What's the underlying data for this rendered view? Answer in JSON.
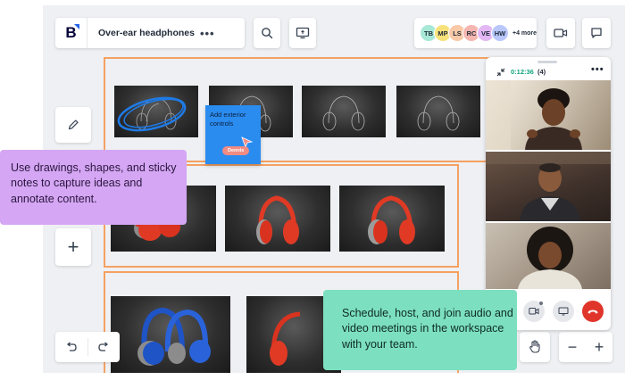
{
  "board": {
    "logo_letter": "B",
    "title": "Over-ear headphones",
    "more_label": "•••"
  },
  "collaborators": {
    "avatars": [
      {
        "initials": "TB",
        "color": "#a7e8d6"
      },
      {
        "initials": "MP",
        "color": "#f7e27a"
      },
      {
        "initials": "LS",
        "color": "#f9c9a8"
      },
      {
        "initials": "RC",
        "color": "#f6b6b0"
      },
      {
        "initials": "VE",
        "color": "#e3b7f4"
      },
      {
        "initials": "HW",
        "color": "#b9c7fb"
      }
    ],
    "more_count": "+4 more"
  },
  "sticky_note": {
    "text": "Add exterior controls",
    "cursor_user": "Dennis",
    "color": "#2b8cf0"
  },
  "video_call": {
    "timer": "0:12:36",
    "participant_count": "(4)",
    "more_label": "•••"
  },
  "callouts": {
    "drawing_tip": "Use drawings, shapes, and sticky notes to capture ideas and annotate content.",
    "meetings_tip": "Schedule, host, and join audio and video meetings in the workspace with your team."
  },
  "zoom": {
    "minus": "−",
    "plus": "+"
  },
  "toolbar": {
    "add_label": "+"
  },
  "colors": {
    "frame_border": "#f5a162",
    "purple_callout": "#d5a6f3",
    "green_callout": "#7ce0c0",
    "hangup": "#e0352b",
    "status_green": "#10a37f"
  }
}
